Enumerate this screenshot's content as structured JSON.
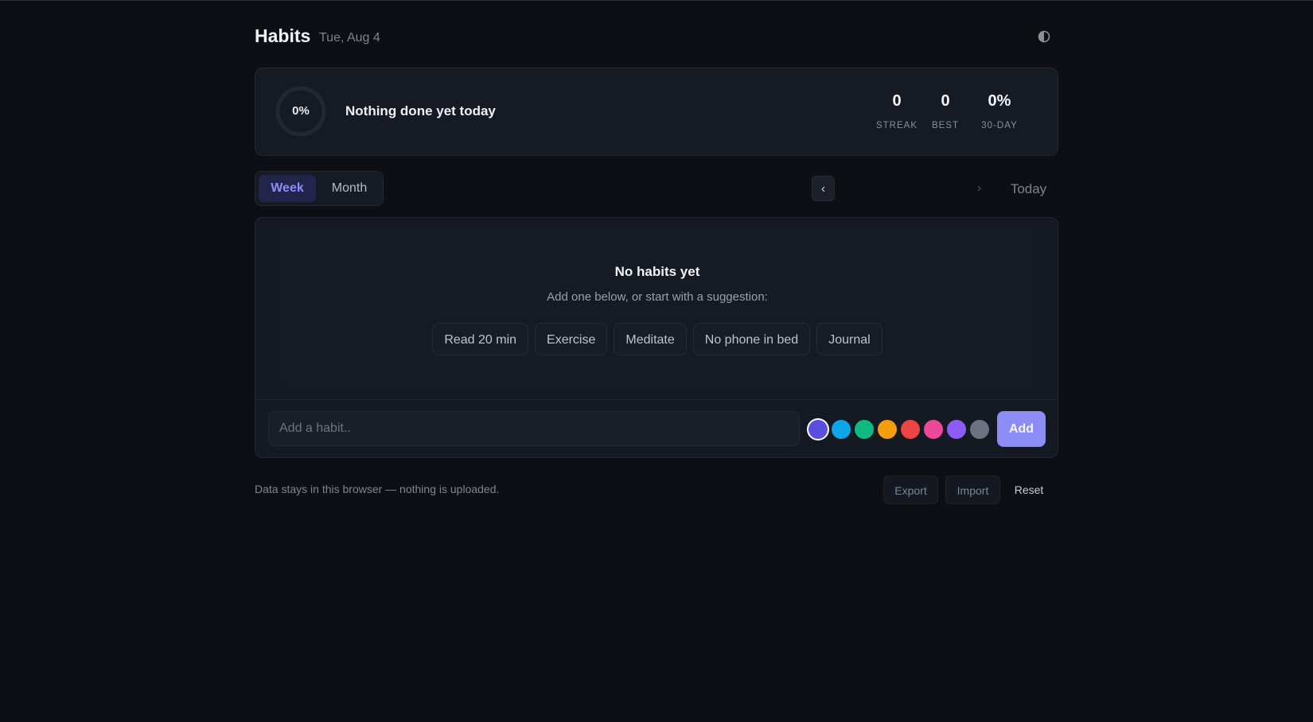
{
  "header": {
    "title": "Habits",
    "date": "Tue, Aug 4",
    "theme_icon": "contrast-icon"
  },
  "summary": {
    "progress_label": "0%",
    "progress": 0,
    "message": "Nothing done yet today",
    "stats": [
      {
        "value": "0",
        "label": "STREAK"
      },
      {
        "value": "0",
        "label": "BEST"
      },
      {
        "value": "0%",
        "label": "30-DAY"
      }
    ]
  },
  "toolbar": {
    "views": [
      "Week",
      "Month"
    ],
    "active_view": "Week",
    "prev_icon": "‹",
    "next_icon": "›",
    "today_label": "Today"
  },
  "empty_state": {
    "title": "No habits yet",
    "subtitle": "Add one below, or start with a suggestion:",
    "suggestions": [
      "Read 20 min",
      "Exercise",
      "Meditate",
      "No phone in bed",
      "Journal"
    ]
  },
  "add_form": {
    "placeholder": "Add a habit..",
    "value": "",
    "colors": [
      "#5b4fe0",
      "#0ea5e9",
      "#10b981",
      "#f59e0b",
      "#ef4444",
      "#ec4899",
      "#8b5cf6",
      "#6b7280"
    ],
    "selected_color": 0,
    "add_label": "Add"
  },
  "footer": {
    "note": "Data stays in this browser — nothing is uploaded.",
    "export_label": "Export",
    "import_label": "Import",
    "reset_label": "Reset"
  }
}
